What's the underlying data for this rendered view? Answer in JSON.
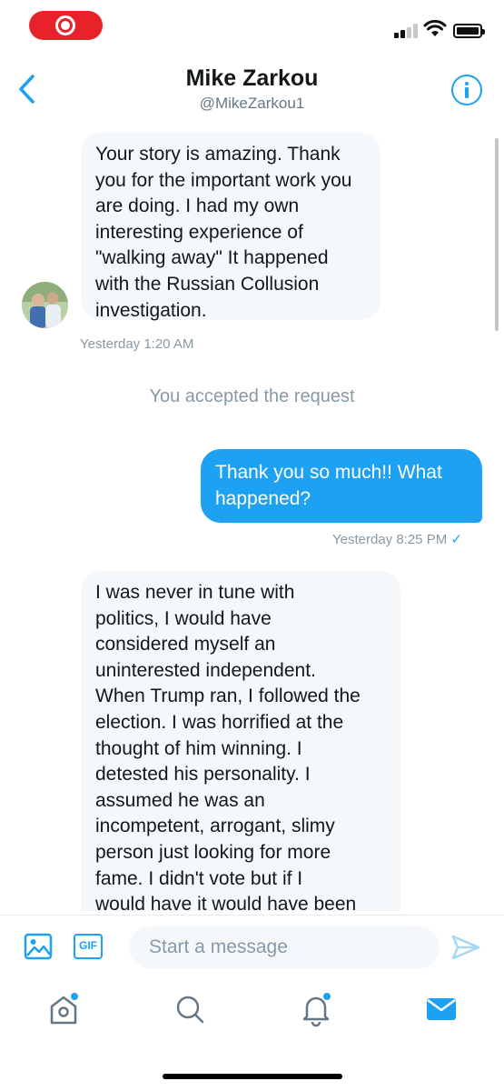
{
  "header": {
    "name": "Mike Zarkou",
    "handle": "@MikeZarkou1"
  },
  "messages": [
    {
      "direction": "incoming",
      "lines": [
        "Your story is amazing. Thank",
        "you for the important work you",
        "are doing. I had my own",
        "interesting experience of",
        "\"walking away\" It happened",
        "with the Russian Collusion",
        "investigation."
      ],
      "timestamp": "Yesterday 1:20 AM"
    },
    {
      "direction": "system",
      "text": "You accepted the request"
    },
    {
      "direction": "outgoing",
      "lines": [
        "Thank you so much!! What",
        "happened?"
      ],
      "timestamp": "Yesterday 8:25 PM",
      "status_icon": "check-icon"
    },
    {
      "direction": "incoming",
      "lines": [
        "I was never in tune with",
        "politics, I would have",
        "considered myself an",
        "uninterested independent.",
        "When Trump ran, I followed the",
        "election. I was horrified at the",
        "thought of him winning. I",
        "detested his personality. I",
        "assumed he was an",
        "incompetent, arrogant, slimy",
        "person just looking for more",
        "fame. I didn't vote but if I",
        "would have it would have been"
      ]
    }
  ],
  "composer": {
    "placeholder": "Start a message",
    "gif_label": "GIF"
  },
  "icons": {
    "back": "chevron-left-icon",
    "info": "info-icon",
    "media": "image-icon",
    "send": "send-icon",
    "tabs": [
      "home-icon",
      "search-icon",
      "bell-icon",
      "mail-icon"
    ]
  },
  "colors": {
    "accent": "#1da1f2",
    "record": "#e8222a",
    "incoming_bubble": "#f5f8fa",
    "muted_text": "#8899a6"
  },
  "tabbar": {
    "active": "mail-icon",
    "badged": [
      "home-icon",
      "bell-icon"
    ]
  }
}
